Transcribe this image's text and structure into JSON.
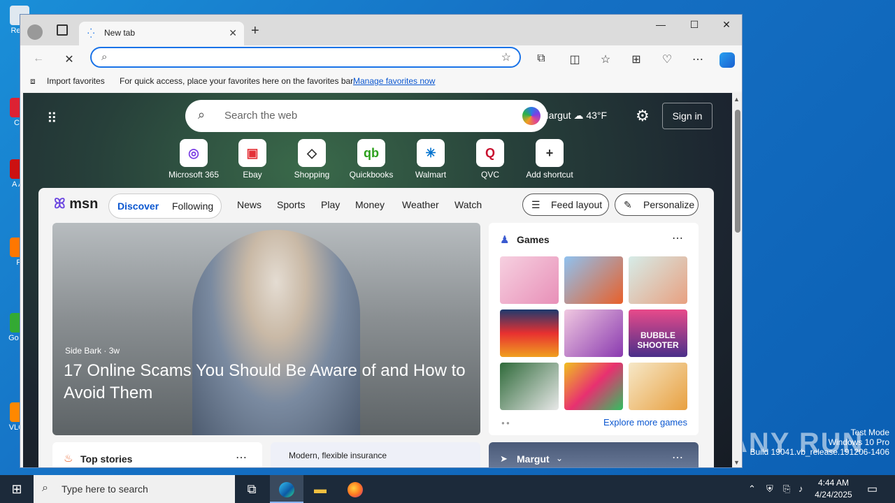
{
  "desktop": {
    "icons": [
      "Recy",
      "CC",
      "A Ac",
      "Fi",
      "Go Ch",
      "VLC p"
    ],
    "watermark_logo": "ANY RUN",
    "watermark_lines": [
      "Test Mode",
      "Windows 10 Pro",
      "Build 19041.vb_release.191206-1406"
    ]
  },
  "browser": {
    "tab_title": "New tab",
    "address_value": "",
    "favbar": {
      "import_label": "Import favorites",
      "hint": "For quick access, place your favorites here on the favorites bar.",
      "manage_link": "Manage favorites now"
    }
  },
  "ntp": {
    "search_placeholder": "Search the web",
    "weather_location": "Margut",
    "weather_temp": "43°F",
    "signin_label": "Sign in",
    "shortcuts": [
      {
        "label": "Microsoft 365",
        "glyph": "◎",
        "color": "#7b3fe4"
      },
      {
        "label": "Ebay",
        "glyph": "▣",
        "color": "#e43137"
      },
      {
        "label": "Shopping",
        "glyph": "◇",
        "color": "#333333"
      },
      {
        "label": "Quickbooks",
        "glyph": "qb",
        "color": "#2ca01c"
      },
      {
        "label": "Walmart",
        "glyph": "✳",
        "color": "#0071ce"
      },
      {
        "label": "QVC",
        "glyph": "Q",
        "color": "#c8102e"
      },
      {
        "label": "Add shortcut",
        "glyph": "+",
        "color": "#333333"
      }
    ]
  },
  "feed": {
    "logo": "msn",
    "pills": [
      "Discover",
      "Following"
    ],
    "nav": [
      "News",
      "Sports",
      "Play",
      "Money",
      "Weather",
      "Watch"
    ],
    "feed_layout_label": "Feed layout",
    "personalize_label": "Personalize",
    "hero": {
      "source": "Side Bark · 3w",
      "headline": "17 Online Scams You Should Be Aware of and How to Avoid Them"
    },
    "games": {
      "title": "Games",
      "explore": "Explore more games",
      "tile_logo": "BUBBLE SHOOTER",
      "tiles": [
        "#f3c5d8",
        "#6aa8e8",
        "#d6ece8",
        "#1d3a6e",
        "#e8c0d8",
        "#4a2f8a",
        "#2f6a3a",
        "#3a9a5a",
        "#f6e8c8"
      ]
    },
    "bottom_cards": {
      "top_stories": "Top stories",
      "insurance": "Modern, flexible insurance",
      "location": "Margut"
    }
  },
  "taskbar": {
    "search_placeholder": "Type here to search",
    "time": "4:44 AM",
    "date": "4/24/2025"
  }
}
